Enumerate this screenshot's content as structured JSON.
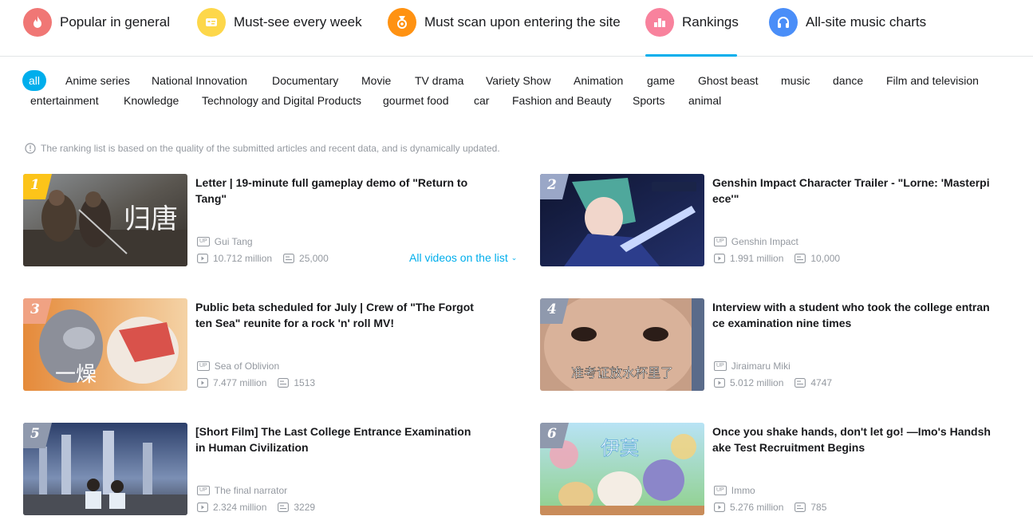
{
  "nav": [
    {
      "label": "Popular in general",
      "icon": "flame-icon",
      "color": "#f07775"
    },
    {
      "label": "Must-see every week",
      "icon": "calendar-card-icon",
      "color": "#fdd74a"
    },
    {
      "label": "Must scan upon entering the site",
      "icon": "medal-icon",
      "color": "#ff9212"
    },
    {
      "label": "Rankings",
      "icon": "podium-icon",
      "color": "#f8829d"
    },
    {
      "label": "All-site music charts",
      "icon": "headphones-icon",
      "color": "#4a8ef8"
    }
  ],
  "nav_active": "Rankings",
  "accent_color": "#00aeec",
  "tags": [
    "all",
    "Anime series",
    "National Innovation",
    "Documentary",
    "Movie",
    "TV drama",
    "Variety Show",
    "Animation",
    "game",
    "Ghost beast",
    "music",
    "dance",
    "Film and television",
    "entertainment",
    "Knowledge",
    "Technology and Digital Products",
    "gourmet food",
    "car",
    "Fashion and Beauty",
    "Sports",
    "animal"
  ],
  "tag_active": "all",
  "notice": "The ranking list is based on the quality of the submitted articles and recent data, and is dynamically updated.",
  "up_badge": "UP",
  "all_videos_label": "All videos on the list",
  "videos": [
    {
      "rank": "1",
      "title": "Letter | 19-minute full gameplay demo of \"Return to Tang\"",
      "up": "Gui Tang",
      "views": "10.712 million",
      "danmaku": "25,000"
    },
    {
      "rank": "2",
      "title": "Genshin Impact Character Trailer - \"Lorne: 'Masterpiece'\"",
      "up": "Genshin Impact",
      "views": "1.991 million",
      "danmaku": "10,000"
    },
    {
      "rank": "3",
      "title": "Public beta scheduled for July | Crew of \"The Forgotten Sea\" reunite for a rock 'n' roll MV!",
      "up": "Sea of Oblivion",
      "views": "7.477 million",
      "danmaku": "1513"
    },
    {
      "rank": "4",
      "title": "Interview with a student who took the college entrance examination nine times",
      "up": "Jiraimaru Miki",
      "views": "5.012 million",
      "danmaku": "4747"
    },
    {
      "rank": "5",
      "title": "[Short Film] The Last College Entrance Examination in Human Civilization",
      "up": "The final narrator",
      "views": "2.324 million",
      "danmaku": "3229"
    },
    {
      "rank": "6",
      "title": "Once you shake hands, don't let go! —Imo's Handshake Test Recruitment Begins",
      "up": "Immo",
      "views": "5.276 million",
      "danmaku": "785"
    }
  ],
  "thumb_text": [
    "归唐",
    "准考证放水杯里了",
    "伊莫",
    "一燥"
  ],
  "rank_colors": [
    "#fcc419",
    "#9aa7c7",
    "#f0a283",
    "#8f99ad",
    "#8f99ad",
    "#8f99ad"
  ]
}
